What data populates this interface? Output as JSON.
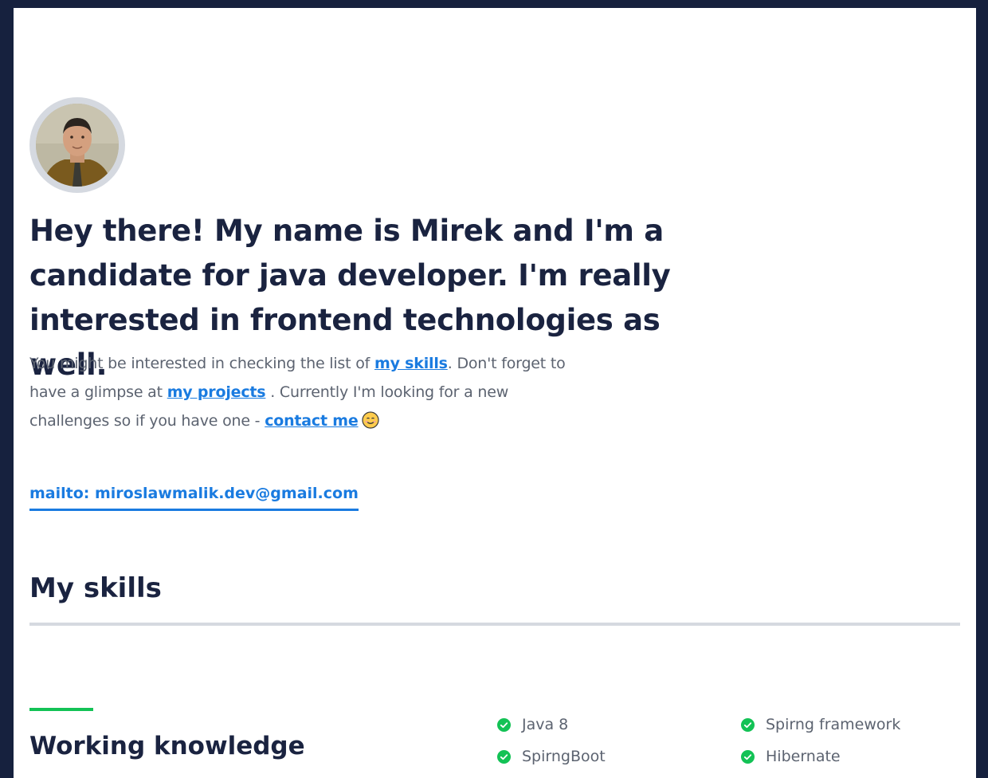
{
  "hero": {
    "title": "Hey there! My name is Mirek and I'm a candidate for java developer. I'm really interested in frontend technologies as well.",
    "text_1": "You might be interested in checking the list of ",
    "link_skills": "my skills",
    "text_2": ". Don't forget to have a glimpse at ",
    "link_projects": "my projects",
    "text_3": " . Currently I'm looking for a new challenges so if you have one - ",
    "link_contact": "contact me",
    "emoji": "smiley-face-icon"
  },
  "mail": {
    "label": "mailto: miroslawmalik.dev@gmail.com"
  },
  "skills_section": {
    "title": "My skills",
    "subsection_title": "Working knowledge",
    "items": [
      "Java 8",
      "Spirng framework",
      "SpirngBoot",
      "Hibernate"
    ]
  },
  "colors": {
    "accent": "#1a7be0",
    "heading": "#1a2340",
    "body_text": "#5c6370",
    "check_green": "#13c255",
    "divider": "#d5d9e0",
    "page_bg": "#16213e"
  }
}
